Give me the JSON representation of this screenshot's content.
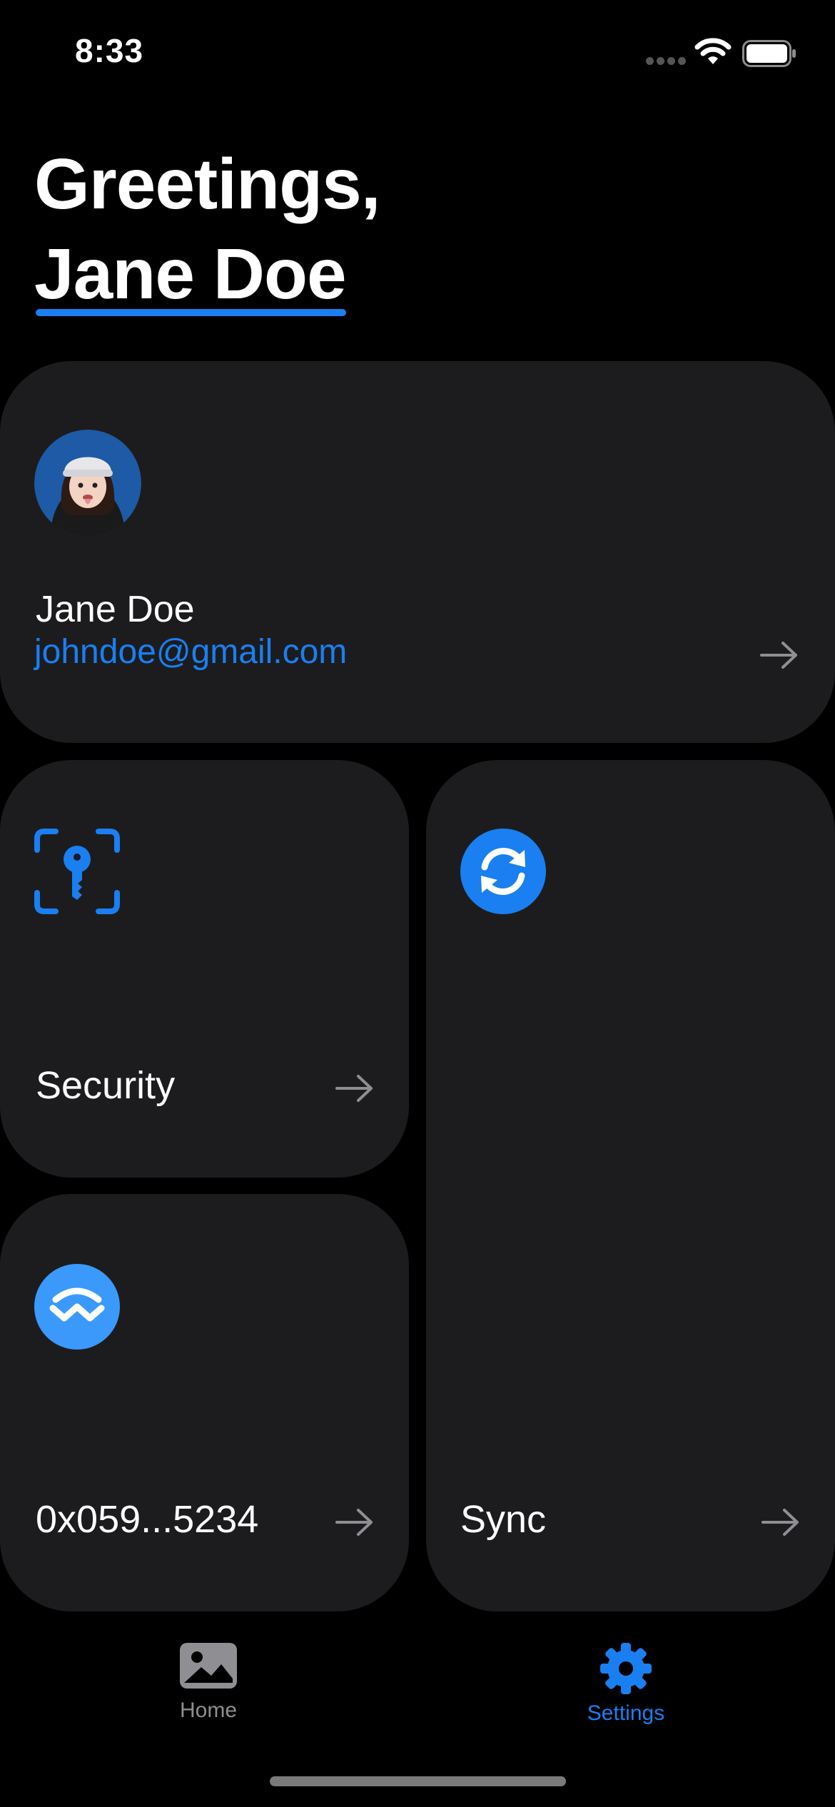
{
  "status_bar": {
    "time": "8:33"
  },
  "greeting": {
    "line1": "Greetings,",
    "line2": "Jane Doe"
  },
  "profile": {
    "name": "Jane Doe",
    "email": "johndoe@gmail.com"
  },
  "cards": {
    "security": {
      "label": "Security"
    },
    "wallet": {
      "label": "0x059...5234"
    },
    "sync": {
      "label": "Sync"
    }
  },
  "tab_bar": {
    "items": [
      {
        "label": "Home",
        "icon": "photo-icon",
        "active": false
      },
      {
        "label": "Settings",
        "icon": "gear-icon",
        "active": true
      }
    ]
  },
  "colors": {
    "background": "#000000",
    "card": "#1c1c1e",
    "accent": "#1a7ff0",
    "text": "#ffffff",
    "muted": "#8e8e93"
  }
}
